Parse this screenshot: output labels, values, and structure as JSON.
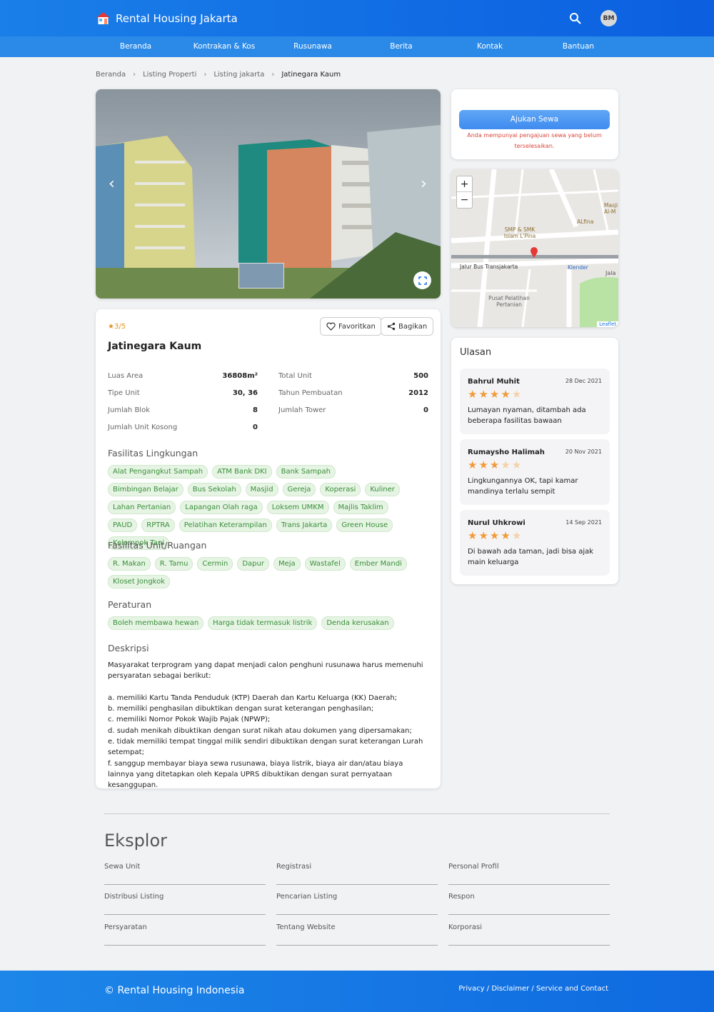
{
  "header": {
    "brand": "Rental Housing Jakarta",
    "avatar": "BM"
  },
  "nav": [
    "Beranda",
    "Kontrakan & Kos",
    "Rusunawa",
    "Berita",
    "Kontak",
    "Bantuan"
  ],
  "breadcrumb": [
    "Beranda",
    "Listing Properti",
    "Listing jakarta",
    "Jatinegara Kaum"
  ],
  "listing": {
    "rating": "3/5",
    "favorite_label": "Favoritkan",
    "share_label": "Bagikan",
    "title": "Jatinegara Kaum",
    "specs_left": [
      {
        "label": "Luas Area",
        "value": "36808m²"
      },
      {
        "label": "Tipe Unit",
        "value": "30, 36"
      },
      {
        "label": "Jumlah Blok",
        "value": "8"
      },
      {
        "label": "Jumlah Unit Kosong",
        "value": "0"
      }
    ],
    "specs_right": [
      {
        "label": "Total Unit",
        "value": "500"
      },
      {
        "label": "Tahun Pembuatan",
        "value": "2012"
      },
      {
        "label": "Jumlah Tower",
        "value": "0"
      }
    ],
    "fasilitas_lingkungan_title": "Fasilitas Lingkungan",
    "fasilitas_lingkungan": [
      "Alat Pengangkut Sampah",
      "ATM Bank DKI",
      "Bank Sampah",
      "Bimbingan Belajar",
      "Bus Sekolah",
      "Masjid",
      "Gereja",
      "Koperasi",
      "Kuliner",
      "Lahan Pertanian",
      "Lapangan Olah raga",
      "Loksem UMKM",
      "Majlis Taklim",
      "PAUD",
      "RPTRA",
      "Pelatihan Keterampilan",
      "Trans Jakarta",
      "Green House",
      "Kelompok Tani"
    ],
    "fasilitas_unit_title": "Fasilitas Unit/Ruangan",
    "fasilitas_unit": [
      "R. Makan",
      "R. Tamu",
      "Cermin",
      "Dapur",
      "Meja",
      "Wastafel",
      "Ember Mandi",
      "Kloset Jongkok"
    ],
    "peraturan_title": "Peraturan",
    "peraturan": [
      "Boleh membawa hewan",
      "Harga tidak termasuk listrik",
      "Denda kerusakan"
    ],
    "deskripsi_title": "Deskripsi",
    "deskripsi": "Masyarakat terprogram yang dapat menjadi calon penghuni rusunawa harus memenuhi persyaratan sebagai berikut:\n\na. memiliki Kartu Tanda Penduduk (KTP) Daerah dan Kartu Keluarga (KK) Daerah;\nb. memiliki penghasilan dibuktikan dengan surat keterangan penghasilan;\nc. memiliki Nomor Pokok Wajib Pajak (NPWP);\nd. sudah menikah dibuktikan dengan surat nikah atau dokumen yang dipersamakan;\ne. tidak memiliki tempat tinggal milik sendiri dibuktikan dengan surat keterangan Lurah setempat;\nf. sanggup membayar biaya sewa rusunawa, biaya listrik, biaya air dan/atau biaya lainnya yang ditetapkan oleh Kepala UPRS dibuktikan dengan surat pernyataan kesanggupan."
  },
  "apply": {
    "button": "Ajukan Sewa",
    "warning": "Anda mempunyai pengajuan sewa yang belum terselesaikan."
  },
  "map": {
    "labels": [
      "SMP & SMK Islam L'Pina",
      "ALfina",
      "Masji Al-M",
      "Jalur Bus Transjakarta",
      "Klender",
      "Jala",
      "Pusat Pelatihan Pertanian",
      "Leaflet"
    ],
    "zoom_in": "+",
    "zoom_out": "−"
  },
  "reviews": {
    "title": "Ulasan",
    "items": [
      {
        "name": "Bahrul Muhit",
        "date": "28 Dec 2021",
        "stars": 4,
        "text": "Lumayan nyaman, ditambah ada beberapa fasilitas bawaan"
      },
      {
        "name": "Rumaysho Halimah",
        "date": "20 Nov 2021",
        "stars": 3,
        "text": "Lingkungannya OK, tapi kamar mandinya terlalu sempit"
      },
      {
        "name": "Nurul Uhkrowi",
        "date": "14 Sep 2021",
        "stars": 4,
        "text": "Di bawah ada taman, jadi bisa ajak main keluarga"
      }
    ]
  },
  "explore": {
    "title": "Eksplor",
    "links": [
      "Sewa Unit",
      "Registrasi",
      "Personal Profil",
      "Distribusi Listing",
      "Pencarian Listing",
      "Respon",
      "Persyaratan",
      "Tentang Website",
      "Korporasi"
    ]
  },
  "footer": {
    "copyright": "© Rental Housing Indonesia",
    "legal": "Privacy / Disclaimer / Service and Contact"
  }
}
